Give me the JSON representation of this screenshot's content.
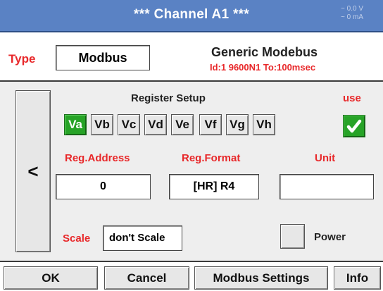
{
  "header": {
    "title": "*** Channel A1 ***",
    "readout_voltage": "~ 0.0 V",
    "readout_current": "~ 0 mA"
  },
  "type_row": {
    "label": "Type",
    "value": "Modbus",
    "device_name": "Generic Modebus",
    "device_params": "Id:1 9600N1 To:100msec"
  },
  "register_setup": {
    "heading": "Register Setup",
    "use_label": "use",
    "use_checked": true,
    "registers": [
      "Va",
      "Vb",
      "Vc",
      "Vd",
      "Ve",
      "Vf",
      "Vg",
      "Vh"
    ],
    "active_register": "Va"
  },
  "fields": {
    "reg_address_label": "Reg.Address",
    "reg_address_value": "0",
    "reg_format_label": "Reg.Format",
    "reg_format_value": "[HR] R4",
    "unit_label": "Unit",
    "unit_value": ""
  },
  "scale": {
    "label": "Scale",
    "value": "don't Scale"
  },
  "power": {
    "label": "Power",
    "checked": false
  },
  "nav": {
    "back_glyph": "<"
  },
  "footer": {
    "ok": "OK",
    "cancel": "Cancel",
    "modbus_settings": "Modbus Settings",
    "info": "Info"
  },
  "colors": {
    "title_bar": "#5a82c4",
    "accent_red": "#e8282a",
    "active_green": "#27a327",
    "panel_bg": "#eeeeee"
  }
}
